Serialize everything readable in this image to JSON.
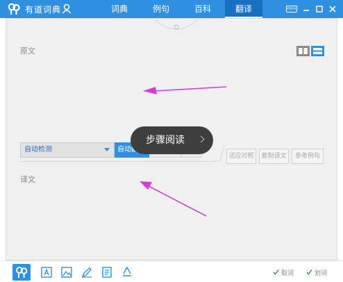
{
  "app": {
    "title": "有道词典",
    "tabs": [
      {
        "label": "词典",
        "active": false
      },
      {
        "label": "例句",
        "active": false
      },
      {
        "label": "百科",
        "active": false
      },
      {
        "label": "翻译",
        "active": true
      }
    ],
    "mini_label": "mini"
  },
  "translation": {
    "source_label": "原文",
    "target_label": "译文",
    "language_select": "自动检测",
    "translate_button": "自动翻译",
    "actions": [
      "适应对照",
      "复制译文",
      "参考例句"
    ]
  },
  "overlay": {
    "toast_label": "步骤阅读"
  },
  "statusbar": {
    "left_text": "取词",
    "right_text": "划词"
  },
  "colors": {
    "accent": "#2f8fe0",
    "toolbar": "#2f8fe0",
    "arrow": "#d63cd6",
    "panel": "#f0f0f0"
  },
  "icons": [
    "logo-icon",
    "user-icon",
    "minimize-icon",
    "maximize-icon",
    "close-icon",
    "split-layout-icon",
    "stack-layout-icon",
    "dict-icon",
    "text-icon",
    "image-icon",
    "pen-icon",
    "document-icon",
    "recycle-icon",
    "chevron-right-icon"
  ]
}
